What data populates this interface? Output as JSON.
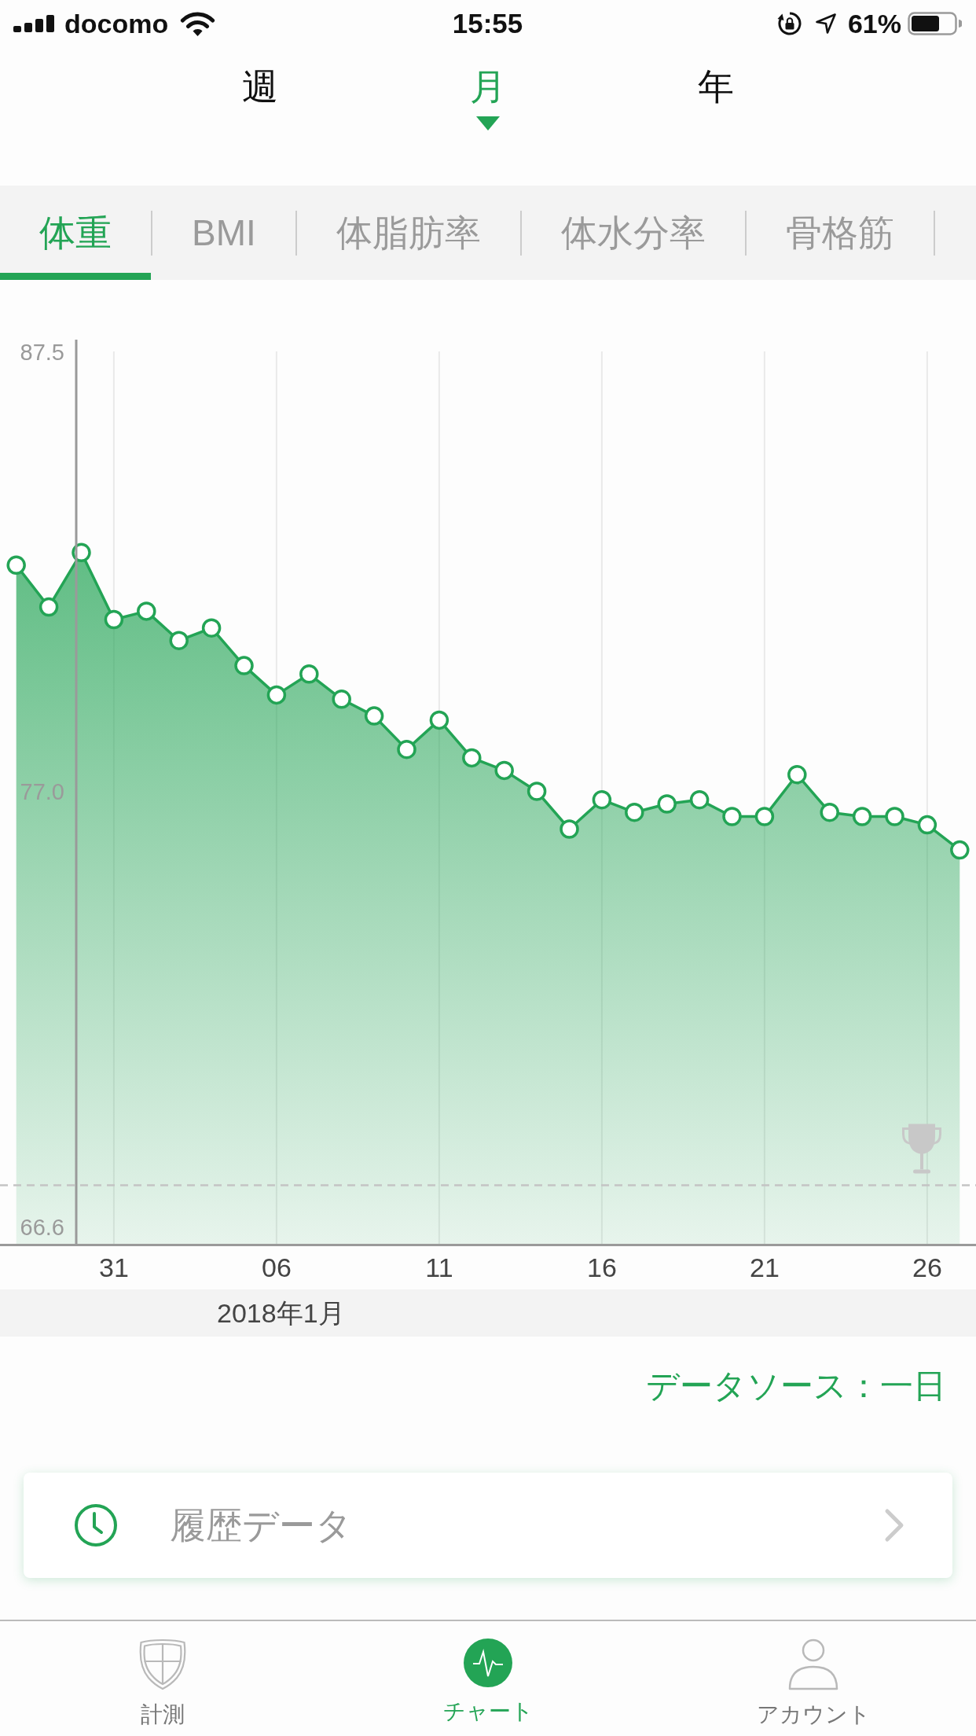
{
  "status_bar": {
    "carrier": "docomo",
    "time": "15:55",
    "battery": "61%"
  },
  "period_tabs": [
    {
      "label": "週",
      "selected": false
    },
    {
      "label": "月",
      "selected": true
    },
    {
      "label": "年",
      "selected": false
    }
  ],
  "metric_tabs": [
    {
      "label": "体重",
      "selected": true
    },
    {
      "label": "BMI",
      "selected": false
    },
    {
      "label": "体脂肪率",
      "selected": false
    },
    {
      "label": "体水分率",
      "selected": false
    },
    {
      "label": "骨格筋",
      "selected": false
    }
  ],
  "chart": {
    "chart_data": {
      "type": "area",
      "categories": [
        null,
        null,
        null,
        "31",
        null,
        null,
        null,
        null,
        "06",
        null,
        null,
        null,
        null,
        "11",
        null,
        null,
        null,
        null,
        "16",
        null,
        null,
        null,
        null,
        "21",
        null,
        null,
        null,
        null,
        "26",
        null
      ],
      "series": [
        {
          "color": "#23a455",
          "values": [
            82.4,
            81.4,
            82.7,
            81.1,
            81.3,
            80.6,
            80.9,
            80.0,
            79.3,
            79.8,
            79.2,
            78.8,
            78.0,
            78.7,
            77.8,
            77.5,
            77.0,
            76.1,
            76.8,
            76.5,
            76.7,
            76.8,
            76.4,
            76.4,
            77.4,
            76.5,
            76.4,
            76.4,
            76.2,
            75.6
          ]
        }
      ],
      "ylim": [
        66.2,
        87.5
      ],
      "yticks": [
        {
          "value": 87.5,
          "label": "87.5"
        },
        {
          "value": 77,
          "label": "77.0"
        },
        {
          "value": 66.6,
          "label": "66.6"
        }
      ],
      "grid": true,
      "ref_lines": [
        {
          "axis": "y",
          "value": 67.6
        }
      ]
    },
    "month_label": "2018年1月"
  },
  "data_source": "データソース：一日",
  "history_row": {
    "label": "履歴データ"
  },
  "tab_bar": [
    {
      "label": "計測",
      "selected": false
    },
    {
      "label": "チャート",
      "selected": true
    },
    {
      "label": "アカウント",
      "selected": false
    }
  ]
}
